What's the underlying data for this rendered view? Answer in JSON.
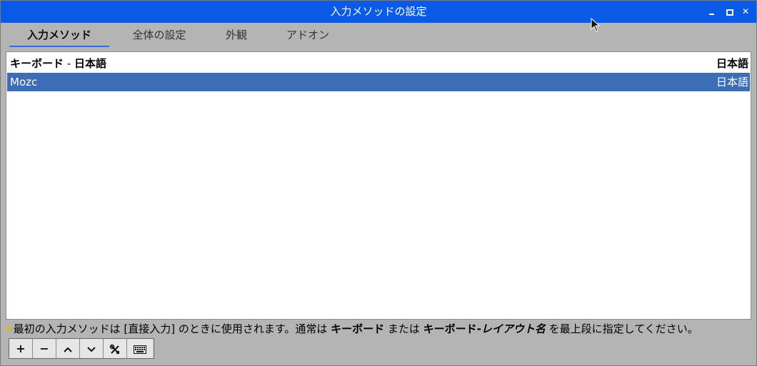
{
  "window": {
    "title": "入力メソッドの設定"
  },
  "tabs": [
    {
      "label": "入力メソッド",
      "active": true
    },
    {
      "label": "全体の設定",
      "active": false
    },
    {
      "label": "外観",
      "active": false
    },
    {
      "label": "アドオン",
      "active": false
    }
  ],
  "list": {
    "header": {
      "name_part1": "キーボード",
      "dash": " - ",
      "name_part2": "日本語",
      "language": "日本語"
    },
    "items": [
      {
        "name": "Mozc",
        "language": "日本語",
        "selected": true
      }
    ]
  },
  "hint": {
    "star": "✦",
    "part1": "最初の入力メソッドは [直接入力] のときに使用されます。通常は ",
    "bold1": "キーボード",
    "part2": " または ",
    "bold2": "キーボード-",
    "italic": "レイアウト名",
    "part3": " を最上段に指定してください。"
  },
  "toolbar": {
    "add": "+",
    "remove": "−",
    "up_icon": "chevron-up-icon",
    "down_icon": "chevron-down-icon",
    "configure_icon": "tools-icon",
    "keyboard_icon": "keyboard-icon"
  },
  "colors": {
    "titlebar": "#0a5ae8",
    "selection": "#3d6eb5",
    "tab_underline": "#3a6bd0",
    "window_bg": "#b4b4b4"
  }
}
